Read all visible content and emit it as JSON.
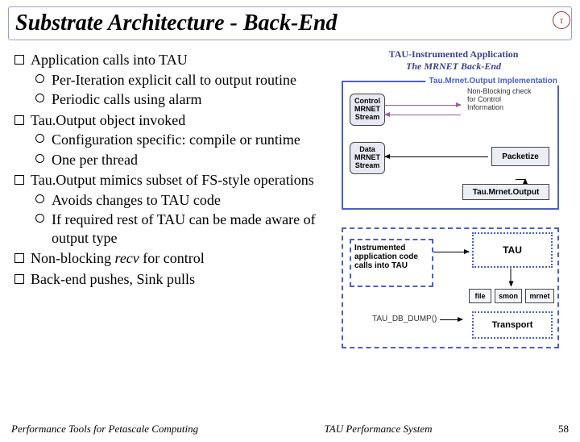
{
  "title": "Substrate Architecture - Back-End",
  "logo_glyph": "τ",
  "bullets": [
    {
      "text": "Application calls into TAU",
      "sub": [
        "Per-Iteration explicit call to output routine",
        "Periodic calls using alarm"
      ]
    },
    {
      "text": "Tau.Output object invoked",
      "sub": [
        "Configuration specific: compile or runtime",
        "One per thread"
      ]
    },
    {
      "text": "Tau.Output mimics subset of FS-style operations",
      "sub": [
        "Avoids changes to TAU code",
        "If required rest of TAU can be made aware of output type"
      ]
    },
    {
      "text_html": "Non-blocking <span class=\"recv-it\">recv</span> for control",
      "sub": []
    },
    {
      "text": "Back-end pushes, Sink pulls",
      "sub": []
    }
  ],
  "diagram": {
    "title": "TAU-Instrumented Application",
    "subtitle": "The MRNET Back-End",
    "control_stream": "Control\nMRNET\nStream",
    "data_stream": "Data\nMRNET\nStream",
    "packetize": "Packetize",
    "nb_check": "Non-Blocking check\nfor Control\nInformation",
    "tmo": "Tau.Mrnet.Output",
    "impl_label": "Tau.Mrnet.Output Implementation",
    "instr_box": "Instrumented application code calls into TAU",
    "tau": "TAU",
    "db_dump": "TAU_DB_DUMP()",
    "transport": "Transport",
    "small": [
      "file",
      "smon",
      "mrnet"
    ],
    "colors": {
      "frame": "#4a5fd0",
      "text": "#3a3f8f"
    }
  },
  "footer": {
    "left": "Performance Tools for Petascale Computing",
    "mid": "TAU Performance System",
    "page": "58"
  }
}
